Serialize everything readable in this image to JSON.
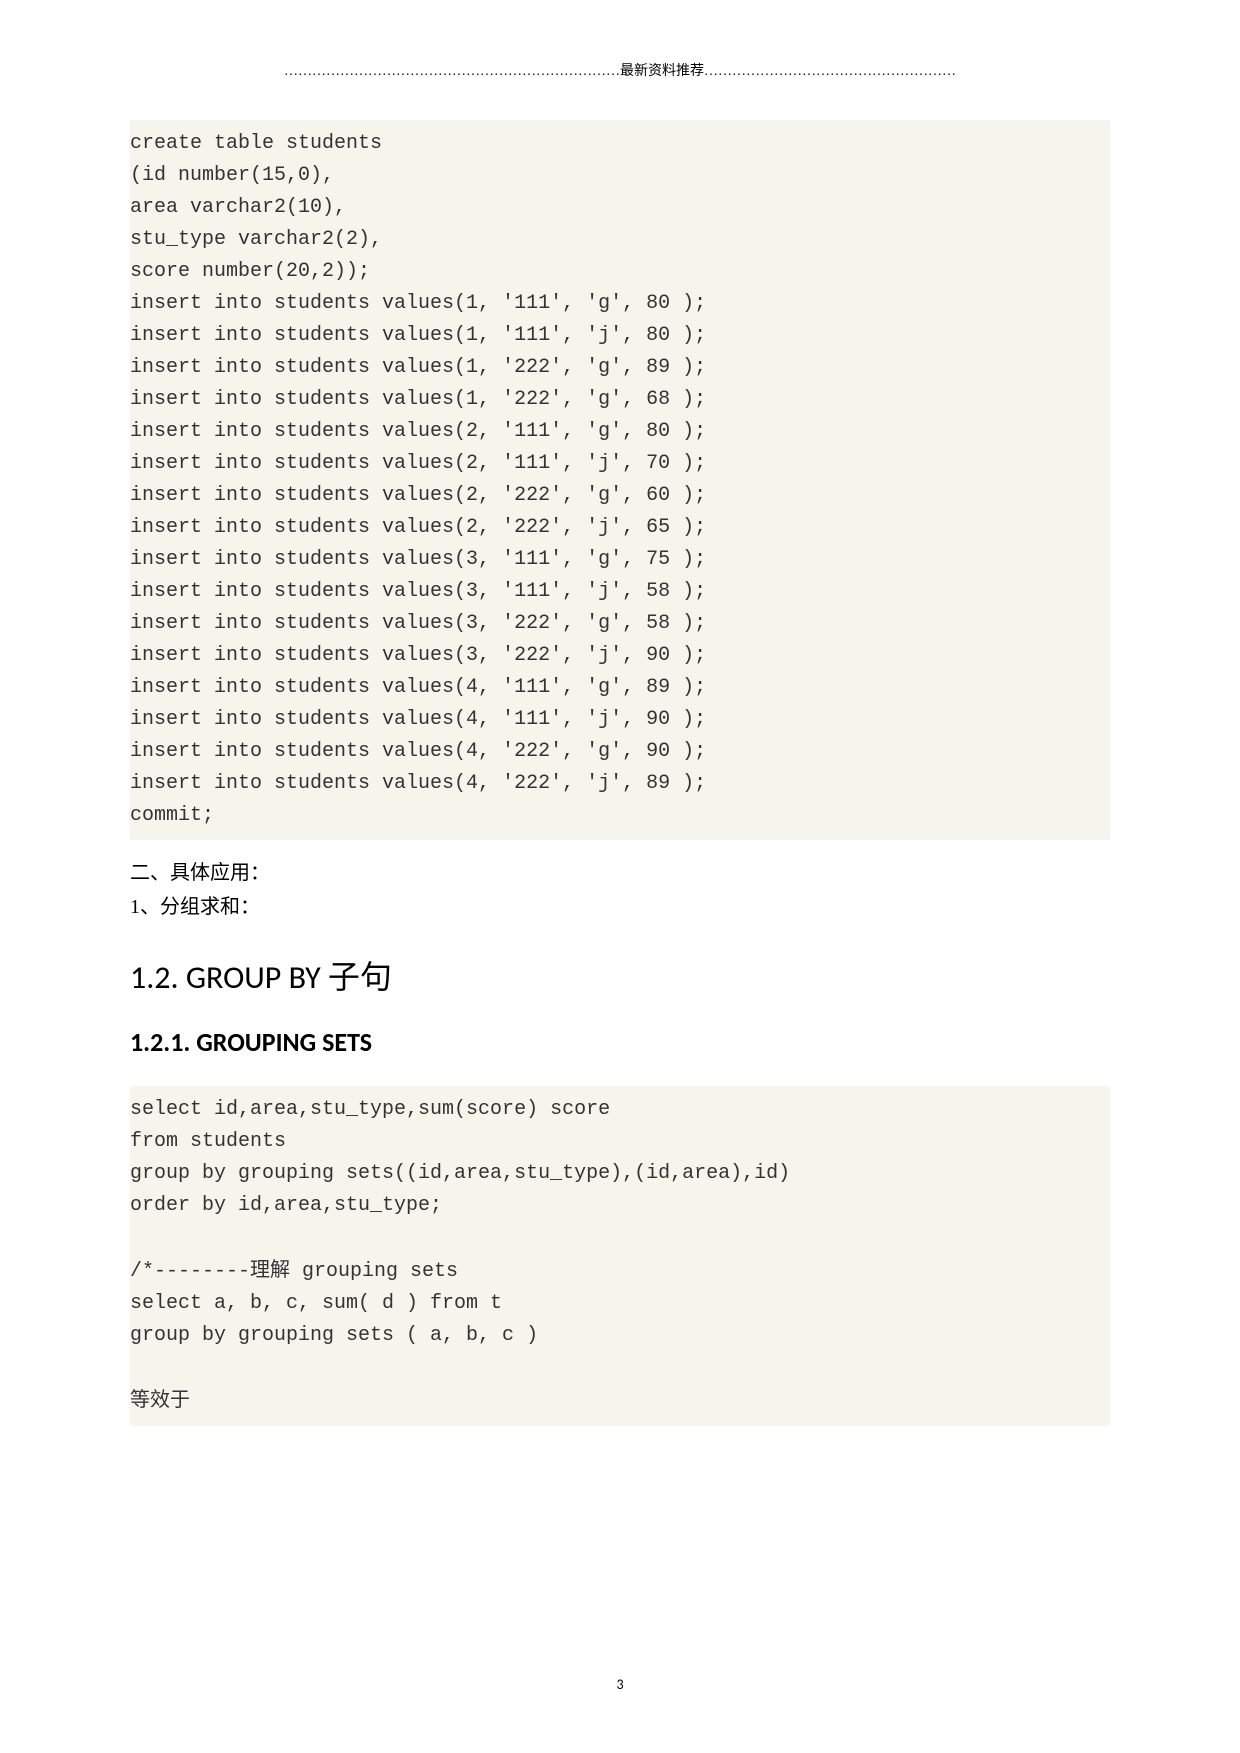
{
  "header": "………………………………………………………………最新资料推荐………………………………………………",
  "code1": "create table students\n(id number(15,0),\narea varchar2(10),\nstu_type varchar2(2),\nscore number(20,2));\ninsert into students values(1, '111', 'g', 80 );\ninsert into students values(1, '111', 'j', 80 );\ninsert into students values(1, '222', 'g', 89 );\ninsert into students values(1, '222', 'g', 68 );\ninsert into students values(2, '111', 'g', 80 );\ninsert into students values(2, '111', 'j', 70 );\ninsert into students values(2, '222', 'g', 60 );\ninsert into students values(2, '222', 'j', 65 );\ninsert into students values(3, '111', 'g', 75 );\ninsert into students values(3, '111', 'j', 58 );\ninsert into students values(3, '222', 'g', 58 );\ninsert into students values(3, '222', 'j', 90 );\ninsert into students values(4, '111', 'g', 89 );\ninsert into students values(4, '111', 'j', 90 );\ninsert into students values(4, '222', 'g', 90 );\ninsert into students values(4, '222', 'j', 89 );\ncommit;",
  "section2": "二、具体应用：",
  "section2_1": "1、分组求和：",
  "h12_pre": "1.2. GROUP BY ",
  "h12_cn": "子句",
  "h121": "1.2.1. GROUPING SETS",
  "code2_a": "select id,area,stu_type,sum(score) score\nfrom students\ngroup by grouping sets((id,area,stu_type),(id,area),id)\norder by id,area,stu_type;\n\n/*--------",
  "code2_b": "理解",
  "code2_c": " grouping sets\nselect a, b, c, sum( d ) from t\ngroup by grouping sets ( a, b, c )\n\n",
  "code2_d": "等效于",
  "pagenum": "3"
}
